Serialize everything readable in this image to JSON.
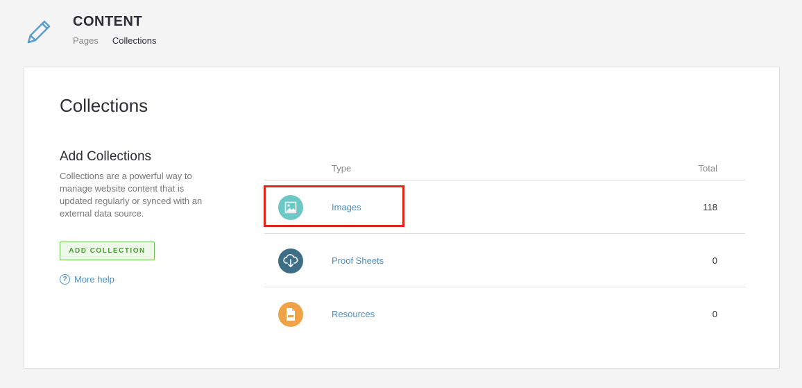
{
  "header": {
    "title": "CONTENT",
    "icon": "pencil-icon",
    "nav": [
      {
        "label": "Pages"
      },
      {
        "label": "Collections"
      }
    ]
  },
  "main": {
    "title": "Collections",
    "sidebar": {
      "title": "Add Collections",
      "description": "Collections are a powerful way to manage website content that is updated regularly or synced with an external data source.",
      "add_button": "ADD COLLECTION",
      "help_icon_glyph": "?",
      "help_link": "More help"
    },
    "table": {
      "columns": {
        "type": "Type",
        "total": "Total"
      },
      "rows": [
        {
          "name": "Images",
          "total": "118",
          "icon": "image-icon",
          "color": "#6dc7c7"
        },
        {
          "name": "Proof Sheets",
          "total": "0",
          "icon": "cloud-download-icon",
          "color": "#3d6e86"
        },
        {
          "name": "Resources",
          "total": "0",
          "icon": "pdf-file-icon",
          "color": "#f0a246"
        }
      ]
    }
  },
  "colors": {
    "accent": "#4d8fbd",
    "add_button": "#6cbf57",
    "highlight": "#e2231a"
  }
}
